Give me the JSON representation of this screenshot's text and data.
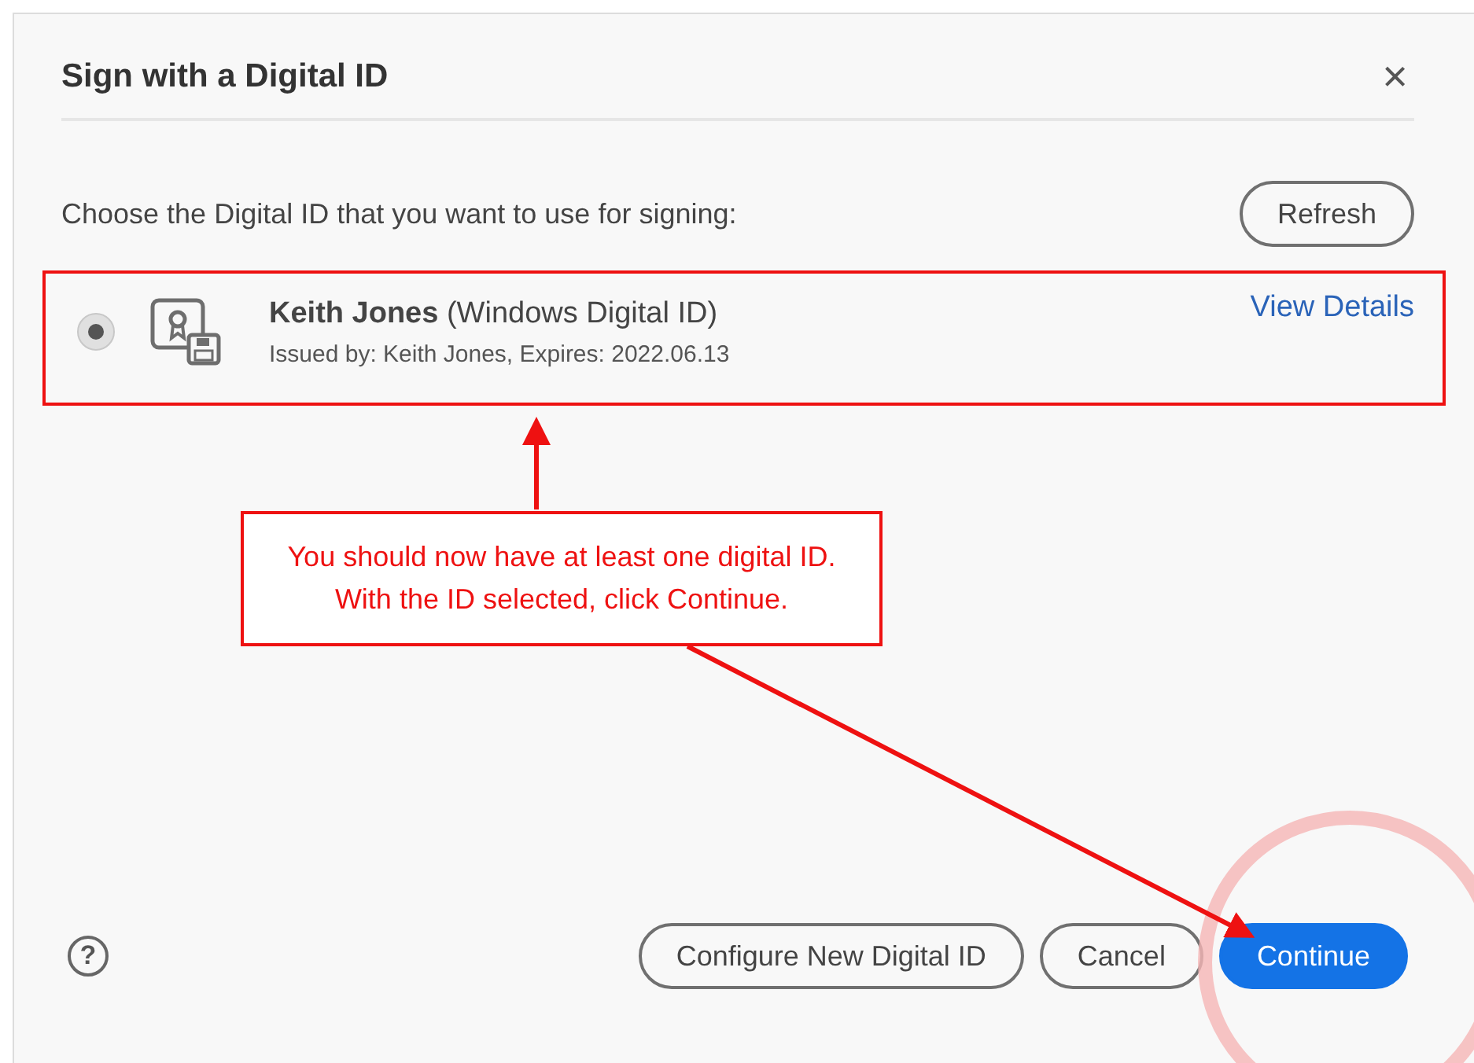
{
  "dialog": {
    "title": "Sign with a Digital ID",
    "close": "×",
    "prompt": "Choose the Digital ID that you want to use for signing:",
    "refresh_button": "Refresh",
    "digital_ids": [
      {
        "label": "**Keith Jones** (Windows Digital ID)",
        "issued": "Issued by: Keith Jones, Expires: 2022.06.13",
        "link": "View Details",
        "selected": true
      }
    ],
    "help": "?",
    "buttons": [
      {
        "label": "Configure New Digital ID",
        "kind": "secondary"
      },
      {
        "label": "Cancel",
        "kind": "secondary"
      },
      {
        "label": "Continue",
        "kind": "primary"
      }
    ]
  },
  "annotation": {
    "callout": "You should now have at least one digital ID. With the ID selected, click Continue."
  }
}
